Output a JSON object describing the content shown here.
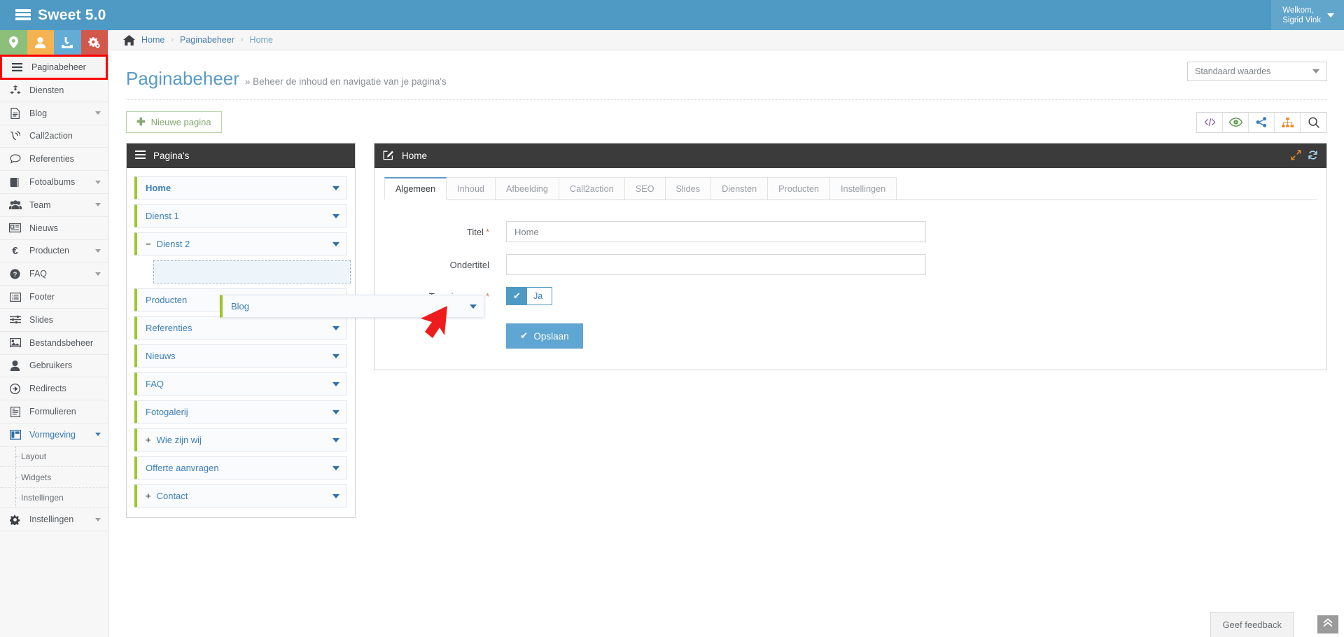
{
  "app": {
    "brand_title": "Sweet 5.0",
    "brand_icon": "server-stack-icon",
    "welcome_label": "Welkom,",
    "user_name": "Sigrid Vink"
  },
  "quick_actions": [
    {
      "name": "map-marker-icon",
      "color": "#8cc07a"
    },
    {
      "name": "user-icon",
      "color": "#f4b350"
    },
    {
      "name": "download-inbox-icon",
      "color": "#62acd6"
    },
    {
      "name": "gears-icon",
      "color": "#d2584b"
    }
  ],
  "sidebar": {
    "items": [
      {
        "label": "Paginabeheer",
        "icon": "hamburger-icon",
        "active": true,
        "chevron": false
      },
      {
        "label": "Diensten",
        "icon": "cubes-icon",
        "active": false,
        "chevron": false
      },
      {
        "label": "Blog",
        "icon": "file-text-icon",
        "active": false,
        "chevron": true
      },
      {
        "label": "Call2action",
        "icon": "phone-volume-icon",
        "active": false,
        "chevron": false
      },
      {
        "label": "Referenties",
        "icon": "comment-icon",
        "active": false,
        "chevron": false
      },
      {
        "label": "Fotoalbums",
        "icon": "book-icon",
        "active": false,
        "chevron": true
      },
      {
        "label": "Team",
        "icon": "users-icon",
        "active": false,
        "chevron": true
      },
      {
        "label": "Nieuws",
        "icon": "newspaper-icon",
        "active": false,
        "chevron": false
      },
      {
        "label": "Producten",
        "icon": "euro-icon",
        "active": false,
        "chevron": true
      },
      {
        "label": "FAQ",
        "icon": "question-circle-icon",
        "active": false,
        "chevron": true
      },
      {
        "label": "Footer",
        "icon": "list-alt-icon",
        "active": false,
        "chevron": false
      },
      {
        "label": "Slides",
        "icon": "sliders-icon",
        "active": false,
        "chevron": false
      },
      {
        "label": "Bestandsbeheer",
        "icon": "image-icon",
        "active": false,
        "chevron": false
      },
      {
        "label": "Gebruikers",
        "icon": "user-icon",
        "active": false,
        "chevron": false
      },
      {
        "label": "Redirects",
        "icon": "arrow-circle-right-icon",
        "active": false,
        "chevron": false
      },
      {
        "label": "Formulieren",
        "icon": "form-icon",
        "active": false,
        "chevron": false
      },
      {
        "label": "Vormgeving",
        "icon": "columns-icon",
        "active": false,
        "chevron": true,
        "accent": true
      }
    ],
    "subitems": [
      "Layout",
      "Widgets",
      "Instellingen"
    ],
    "bottom_item": {
      "label": "Instellingen",
      "icon": "gear-icon",
      "chevron": true
    }
  },
  "breadcrumb": {
    "home_icon": "home-icon",
    "items": [
      "Home",
      "Paginabeheer",
      "Home"
    ],
    "separator": "›"
  },
  "page": {
    "title": "Paginabeheer",
    "subtitle": "» Beheer de inhoud en navigatie van je pagina's",
    "preset_select": "Standaard waardes",
    "new_page_button": "Nieuwe pagina",
    "new_page_icon": "plus-icon"
  },
  "icon_toolbar": [
    {
      "name": "code-icon",
      "glyph": "</>",
      "color": "#8a5fa8"
    },
    {
      "name": "eye-icon",
      "glyph": "◉",
      "color": "#4c9a3f"
    },
    {
      "name": "share-icon",
      "glyph": "share",
      "color": "#3a7fc1"
    },
    {
      "name": "sitemap-icon",
      "glyph": "sitemap",
      "color": "#e8892a"
    },
    {
      "name": "search-icon",
      "glyph": "⌕",
      "color": "#3c4044"
    }
  ],
  "pages_panel": {
    "header": "Pagina's",
    "header_icon": "hamburger-icon",
    "rows": [
      {
        "label": "Home",
        "bold": true,
        "toggle": null
      },
      {
        "label": "Dienst 1",
        "bold": false,
        "toggle": null
      },
      {
        "label": "Dienst 2",
        "bold": false,
        "toggle": "−"
      },
      {
        "label": "Producten",
        "bold": false,
        "toggle": null
      },
      {
        "label": "Referenties",
        "bold": false,
        "toggle": null
      },
      {
        "label": "Nieuws",
        "bold": false,
        "toggle": null
      },
      {
        "label": "FAQ",
        "bold": false,
        "toggle": null
      },
      {
        "label": "Fotogalerij",
        "bold": false,
        "toggle": null
      },
      {
        "label": "Wie zijn wij",
        "bold": false,
        "toggle": "+"
      },
      {
        "label": "Offerte aanvragen",
        "bold": false,
        "toggle": null
      },
      {
        "label": "Contact",
        "bold": false,
        "toggle": "+"
      }
    ],
    "dragging_item": "Blog",
    "drop_placeholder_after_index": 2
  },
  "edit_panel": {
    "header": "Home",
    "header_icon": "edit-pencil-icon",
    "expand_icon": "expand-arrows-icon",
    "refresh_icon": "refresh-icon",
    "tabs": [
      {
        "label": "Algemeen",
        "active": true
      },
      {
        "label": "Inhoud",
        "active": false
      },
      {
        "label": "Afbeelding",
        "active": false
      },
      {
        "label": "Call2action",
        "active": false
      },
      {
        "label": "SEO",
        "active": false
      },
      {
        "label": "Slides",
        "active": false
      },
      {
        "label": "Diensten",
        "active": false
      },
      {
        "label": "Producten",
        "active": false
      },
      {
        "label": "Instellingen",
        "active": false
      }
    ],
    "form": {
      "titel_label": "Titel",
      "titel_value": "Home",
      "titel_required": "*",
      "ondertitel_label": "Ondertitel",
      "ondertitel_value": "",
      "ondertitel_placeholder": "",
      "toon_label": "Toon in menu",
      "toon_required": "*",
      "toon_value": "Ja",
      "toon_checked_icon": "check-icon",
      "save_label": "Opslaan",
      "save_icon": "check-icon"
    }
  },
  "footer": {
    "feedback_label": "Geef feedback",
    "scroll_top_icon": "chevron-double-up-icon"
  },
  "colors": {
    "brand_blue": "#4f9ac4",
    "accent_link": "#337ab7",
    "tree_green": "#9ec629",
    "highlight_red": "#ff0000",
    "panel_dark": "#3b3b3b"
  }
}
